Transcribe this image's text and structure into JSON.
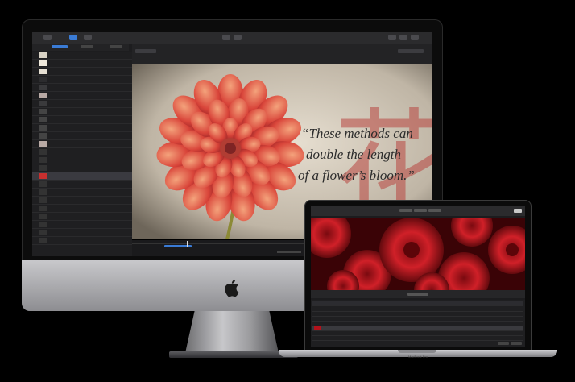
{
  "motion": {
    "canvas_quote_line1": "“These methods can",
    "canvas_quote_line2": "double the length",
    "canvas_quote_line3": "of a flower’s bloom.”",
    "canvas_kanji": "花"
  },
  "macbook": {
    "label": "MacBook Pro"
  },
  "colors": {
    "accent_blue": "#3a7bd5",
    "canvas_paper": "#d8cfbf",
    "flower_red": "#c8302f",
    "compressor_red": "#b3121b"
  }
}
